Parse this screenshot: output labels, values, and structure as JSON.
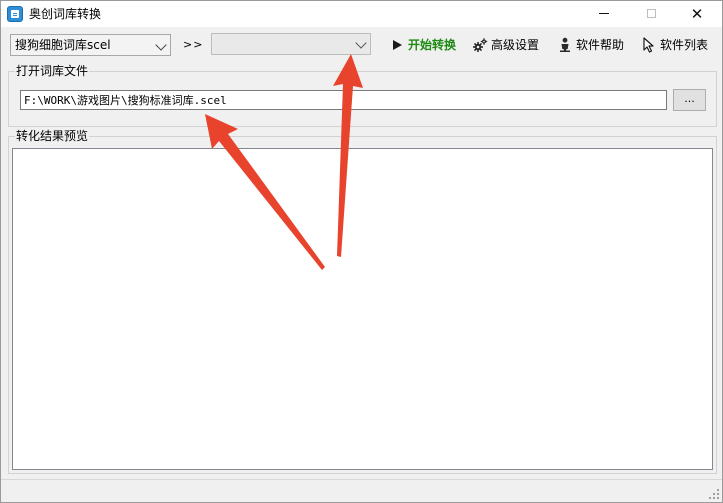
{
  "window": {
    "title": "奥创词库转换",
    "minimize_icon": "minimize-icon",
    "maximize_icon": "maximize-icon",
    "close_icon": "close-icon"
  },
  "toolbar": {
    "source_format": {
      "selected": "搜狗细胞词库scel"
    },
    "separator": ">>",
    "target_format": {
      "selected": ""
    },
    "start_button": {
      "label": "开始转换",
      "icon": "play-icon",
      "color": "#1f8a14"
    },
    "settings_button": {
      "label": "高级设置",
      "icon": "gears-icon"
    },
    "help_button": {
      "label": "软件帮助",
      "icon": "person-icon"
    },
    "list_button": {
      "label": "软件列表",
      "icon": "cursor-icon"
    }
  },
  "open_file_group": {
    "legend": "打开词库文件",
    "file_path": "F:\\WORK\\游戏图片\\搜狗标准词库.scel",
    "browse_label": "..."
  },
  "preview_group": {
    "legend": "转化结果预览",
    "content": ""
  },
  "annotation": {
    "arrow_color": "#e8432d",
    "arrow_count": 2
  }
}
